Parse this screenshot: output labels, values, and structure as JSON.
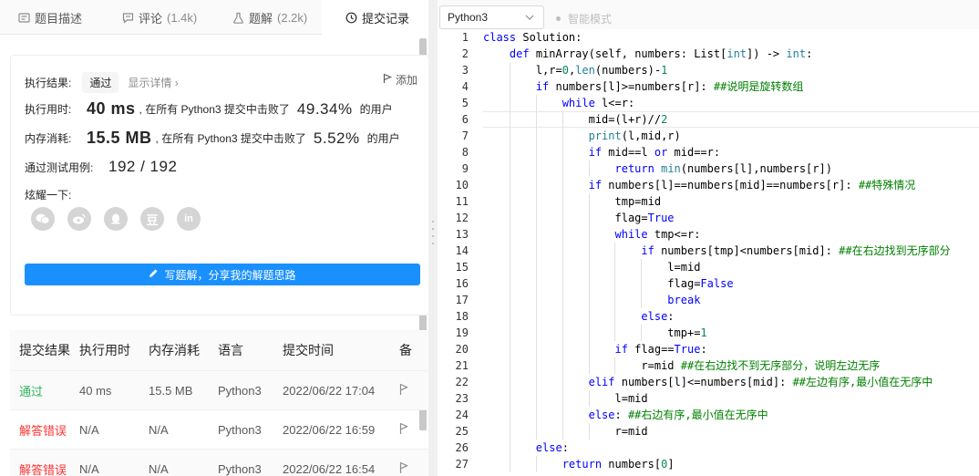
{
  "tabs": [
    {
      "label": "题目描述",
      "count": "",
      "icon": "description-icon"
    },
    {
      "label": "评论",
      "count": "(1.4k)",
      "icon": "comment-icon"
    },
    {
      "label": "题解",
      "count": "(2.2k)",
      "icon": "flask-icon"
    },
    {
      "label": "提交记录",
      "count": "",
      "icon": "clock-icon"
    }
  ],
  "result": {
    "exec_result_label": "执行结果:",
    "status": "通过",
    "detail_link": "显示详情 ›",
    "add_note": "添加",
    "time_label": "执行用时:",
    "time_value": "40 ms",
    "time_text": ", 在所有 Python3 提交中击败了",
    "time_percent": "49.34%",
    "time_suffix": "的用户",
    "mem_label": "内存消耗:",
    "mem_value": "15.5 MB",
    "mem_text": ", 在所有 Python3 提交中击败了",
    "mem_percent": "5.52%",
    "mem_suffix": "的用户",
    "cases_label": "通过测试用例:",
    "cases_value": "192 / 192",
    "share_label": "炫耀一下:",
    "share_icons": [
      "微",
      "微",
      "Q",
      "豆",
      "in"
    ],
    "write_solution_button": "写题解，分享我的解题思路"
  },
  "table": {
    "headers": [
      "提交结果",
      "执行用时",
      "内存消耗",
      "语言",
      "提交时间",
      "备"
    ],
    "rows": [
      {
        "result": "通过",
        "kind": "ok",
        "time": "40 ms",
        "mem": "15.5 MB",
        "lang": "Python3",
        "submitted": "2022/06/22 17:04"
      },
      {
        "result": "解答错误",
        "kind": "err",
        "time": "N/A",
        "mem": "N/A",
        "lang": "Python3",
        "submitted": "2022/06/22 16:59"
      },
      {
        "result": "解答错误",
        "kind": "err",
        "time": "N/A",
        "mem": "N/A",
        "lang": "Python3",
        "submitted": "2022/06/22 16:54"
      }
    ]
  },
  "editor": {
    "language": "Python3",
    "smart_mode": "智能模式",
    "current_line": 6,
    "lines": [
      [
        [
          "kw",
          "class"
        ],
        [
          "t",
          " Solution:"
        ]
      ],
      [
        [
          "t",
          "    "
        ],
        [
          "kw",
          "def"
        ],
        [
          "t",
          " minArray(self, numbers: List["
        ],
        [
          "ty",
          "int"
        ],
        [
          "t",
          "]) -> "
        ],
        [
          "ty",
          "int"
        ],
        [
          "t",
          ":"
        ]
      ],
      [
        [
          "t",
          "        l,r="
        ],
        [
          "num",
          "0"
        ],
        [
          "t",
          ","
        ],
        [
          "bi",
          "len"
        ],
        [
          "t",
          "(numbers)-"
        ],
        [
          "num",
          "1"
        ]
      ],
      [
        [
          "t",
          "        "
        ],
        [
          "kw",
          "if"
        ],
        [
          "t",
          " numbers[l]>=numbers[r]: "
        ],
        [
          "cm",
          "##说明是旋转数组"
        ]
      ],
      [
        [
          "t",
          "            "
        ],
        [
          "kw",
          "while"
        ],
        [
          "t",
          " l<=r:"
        ]
      ],
      [
        [
          "t",
          "                mid=(l+r)//"
        ],
        [
          "num",
          "2"
        ]
      ],
      [
        [
          "t",
          "                "
        ],
        [
          "bi",
          "print"
        ],
        [
          "t",
          "(l,mid,r)"
        ]
      ],
      [
        [
          "t",
          "                "
        ],
        [
          "kw",
          "if"
        ],
        [
          "t",
          " mid==l "
        ],
        [
          "kw",
          "or"
        ],
        [
          "t",
          " mid==r:"
        ]
      ],
      [
        [
          "t",
          "                    "
        ],
        [
          "kw",
          "return"
        ],
        [
          "t",
          " "
        ],
        [
          "bi",
          "min"
        ],
        [
          "t",
          "(numbers[l],numbers[r])"
        ]
      ],
      [
        [
          "t",
          "                "
        ],
        [
          "kw",
          "if"
        ],
        [
          "t",
          " numbers[l]==numbers[mid]==numbers[r]: "
        ],
        [
          "cm",
          "##特殊情况"
        ]
      ],
      [
        [
          "t",
          "                    tmp=mid"
        ]
      ],
      [
        [
          "t",
          "                    flag="
        ],
        [
          "kw",
          "True"
        ]
      ],
      [
        [
          "t",
          "                    "
        ],
        [
          "kw",
          "while"
        ],
        [
          "t",
          " tmp<=r:"
        ]
      ],
      [
        [
          "t",
          "                        "
        ],
        [
          "kw",
          "if"
        ],
        [
          "t",
          " numbers[tmp]<numbers[mid]: "
        ],
        [
          "cm",
          "##在右边找到无序部分"
        ]
      ],
      [
        [
          "t",
          "                            l=mid"
        ]
      ],
      [
        [
          "t",
          "                            flag="
        ],
        [
          "kw",
          "False"
        ]
      ],
      [
        [
          "t",
          "                            "
        ],
        [
          "kw",
          "break"
        ]
      ],
      [
        [
          "t",
          "                        "
        ],
        [
          "kw",
          "else"
        ],
        [
          "t",
          ":"
        ]
      ],
      [
        [
          "t",
          "                            tmp+="
        ],
        [
          "num",
          "1"
        ]
      ],
      [
        [
          "t",
          "                    "
        ],
        [
          "kw",
          "if"
        ],
        [
          "t",
          " flag=="
        ],
        [
          "kw",
          "True"
        ],
        [
          "t",
          ":"
        ]
      ],
      [
        [
          "t",
          "                        r=mid "
        ],
        [
          "cm",
          "##在右边找不到无序部分，说明左边无序"
        ]
      ],
      [
        [
          "t",
          "                "
        ],
        [
          "kw",
          "elif"
        ],
        [
          "t",
          " numbers[l]<=numbers[mid]: "
        ],
        [
          "cm",
          "##左边有序,最小值在无序中"
        ]
      ],
      [
        [
          "t",
          "                    l=mid"
        ]
      ],
      [
        [
          "t",
          "                "
        ],
        [
          "kw",
          "else"
        ],
        [
          "t",
          ": "
        ],
        [
          "cm",
          "##右边有序,最小值在无序中"
        ]
      ],
      [
        [
          "t",
          "                    r=mid"
        ]
      ],
      [
        [
          "t",
          "        "
        ],
        [
          "kw",
          "else"
        ],
        [
          "t",
          ":"
        ]
      ],
      [
        [
          "t",
          "            "
        ],
        [
          "kw",
          "return"
        ],
        [
          "t",
          " numbers["
        ],
        [
          "num",
          "0"
        ],
        [
          "t",
          "]"
        ]
      ]
    ]
  }
}
